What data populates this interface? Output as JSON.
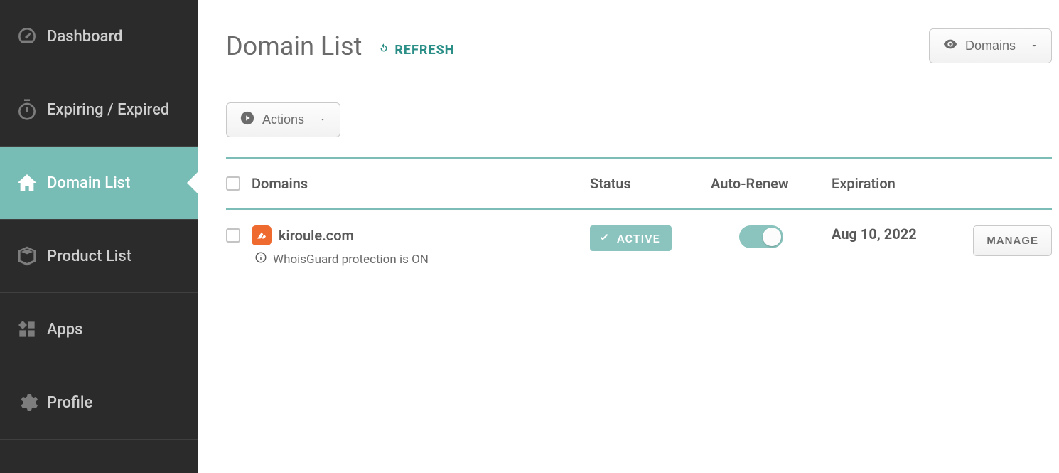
{
  "sidebar": {
    "items": [
      {
        "label": "Dashboard"
      },
      {
        "label": "Expiring / Expired"
      },
      {
        "label": "Domain List"
      },
      {
        "label": "Product List"
      },
      {
        "label": "Apps"
      },
      {
        "label": "Profile"
      }
    ]
  },
  "header": {
    "title": "Domain List",
    "refresh_label": "REFRESH",
    "view_dropdown_label": "Domains"
  },
  "toolbar": {
    "actions_label": "Actions"
  },
  "table": {
    "headers": {
      "domains": "Domains",
      "status": "Status",
      "auto_renew": "Auto-Renew",
      "expiration": "Expiration"
    },
    "rows": [
      {
        "domain": "kiroule.com",
        "whois_note": "WhoisGuard protection is ON",
        "status_label": "ACTIVE",
        "auto_renew": true,
        "expiration": "Aug 10, 2022",
        "manage_label": "MANAGE"
      }
    ]
  }
}
